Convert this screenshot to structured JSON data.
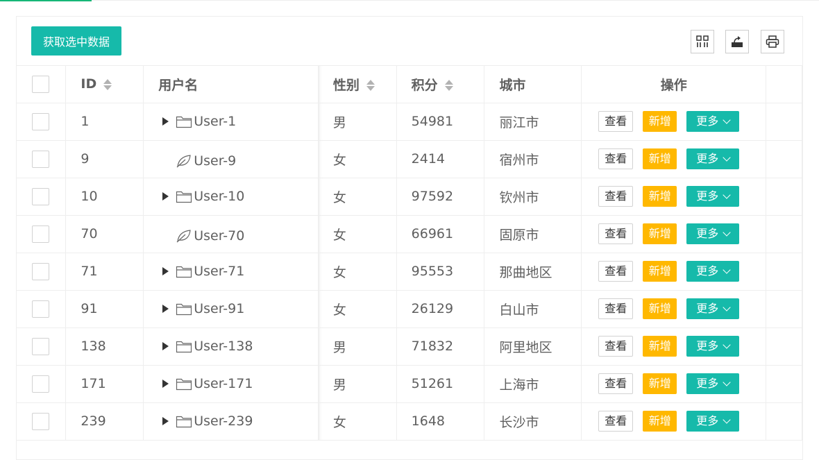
{
  "toolbar": {
    "get_selected_label": "获取选中数据",
    "icons": [
      "columns-icon",
      "export-icon",
      "print-icon"
    ]
  },
  "table": {
    "headers": {
      "id": "ID",
      "username": "用户名",
      "gender": "性别",
      "score": "积分",
      "city": "城市",
      "actions": "操作"
    },
    "rows": [
      {
        "id": "1",
        "username": "User-1",
        "type": "folder",
        "gender": "男",
        "score": "54981",
        "city": "丽江市"
      },
      {
        "id": "9",
        "username": "User-9",
        "type": "leaf",
        "gender": "女",
        "score": "2414",
        "city": "宿州市"
      },
      {
        "id": "10",
        "username": "User-10",
        "type": "folder",
        "gender": "女",
        "score": "97592",
        "city": "钦州市"
      },
      {
        "id": "70",
        "username": "User-70",
        "type": "leaf",
        "gender": "女",
        "score": "66961",
        "city": "固原市"
      },
      {
        "id": "71",
        "username": "User-71",
        "type": "folder",
        "gender": "女",
        "score": "95553",
        "city": "那曲地区"
      },
      {
        "id": "91",
        "username": "User-91",
        "type": "folder",
        "gender": "女",
        "score": "26129",
        "city": "白山市"
      },
      {
        "id": "138",
        "username": "User-138",
        "type": "folder",
        "gender": "男",
        "score": "71832",
        "city": "阿里地区"
      },
      {
        "id": "171",
        "username": "User-171",
        "type": "folder",
        "gender": "男",
        "score": "51261",
        "city": "上海市"
      },
      {
        "id": "239",
        "username": "User-239",
        "type": "folder",
        "gender": "女",
        "score": "1648",
        "city": "长沙市"
      }
    ],
    "actions": {
      "view": "查看",
      "add": "新增",
      "more": "更多"
    }
  },
  "colors": {
    "primary": "#16baaa",
    "warning": "#ffb800",
    "accent_top": "#16b777"
  }
}
